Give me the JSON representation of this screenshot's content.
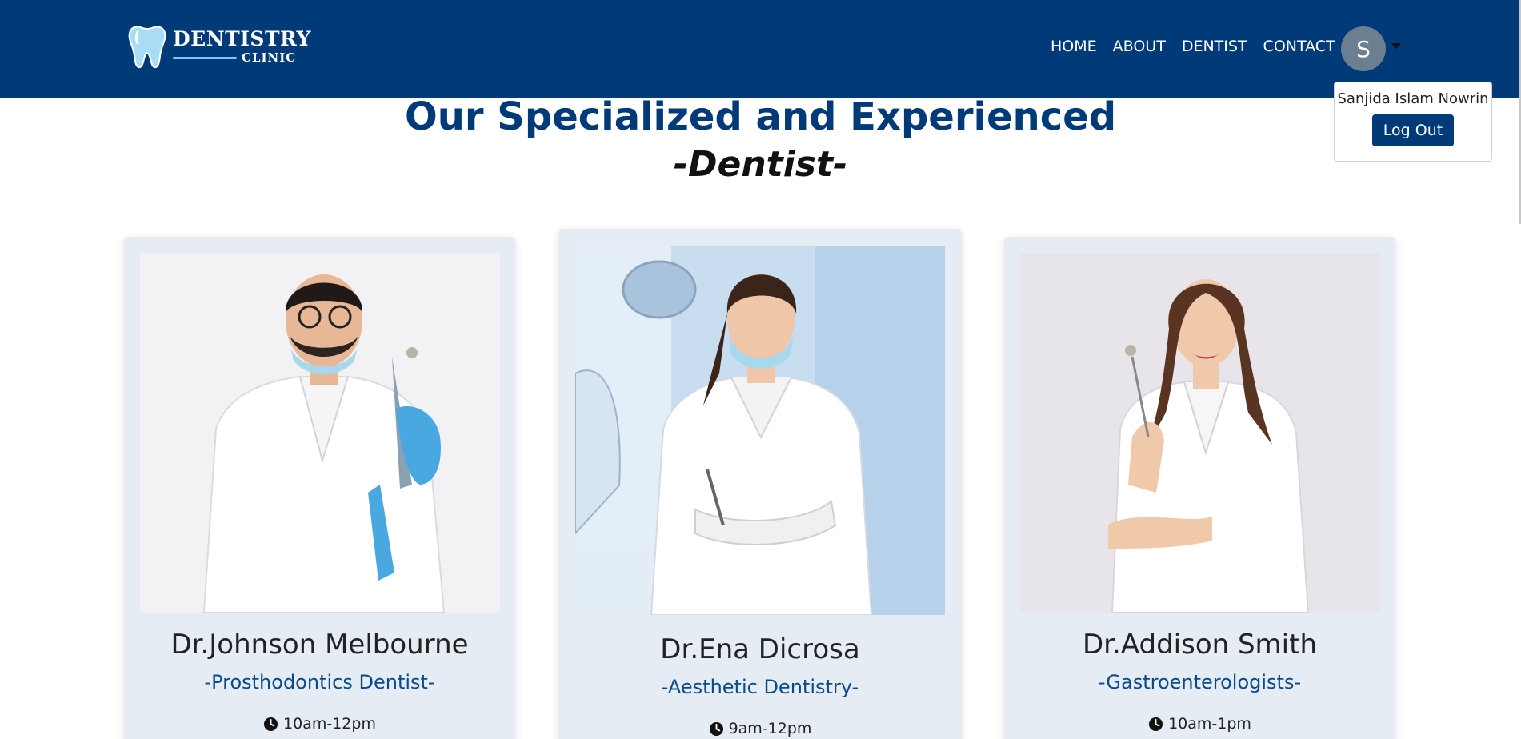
{
  "brand": {
    "name": "DENTISTRY",
    "sub": "CLINIC"
  },
  "nav": {
    "links": [
      "HOME",
      "ABOUT",
      "DENTIST",
      "CONTACT"
    ],
    "avatar_initial": "S",
    "dropdown_user": "Sanjida Islam Nowrin",
    "logout_label": "Log Out"
  },
  "section": {
    "title": "Our Specialized and Experienced",
    "subtitle": "-Dentist-"
  },
  "dentists": [
    {
      "name": "Dr.Johnson Melbourne",
      "specialty": "-Prosthodontics Dentist-",
      "hours": "10am-12pm"
    },
    {
      "name": "Dr.Ena Dicrosa",
      "specialty": "-Aesthetic Dentistry-",
      "hours": "9am-12pm"
    },
    {
      "name": "Dr.Addison Smith",
      "specialty": "-Gastroenterologists-",
      "hours": "10am-1pm"
    }
  ],
  "colors": {
    "primary": "#003a78",
    "card_bg": "#e6ecf3",
    "accent": "#7fc9f0"
  },
  "icons": {
    "clock": "clock-icon",
    "tooth": "tooth-logo-icon",
    "caret": "caret-down-icon"
  }
}
